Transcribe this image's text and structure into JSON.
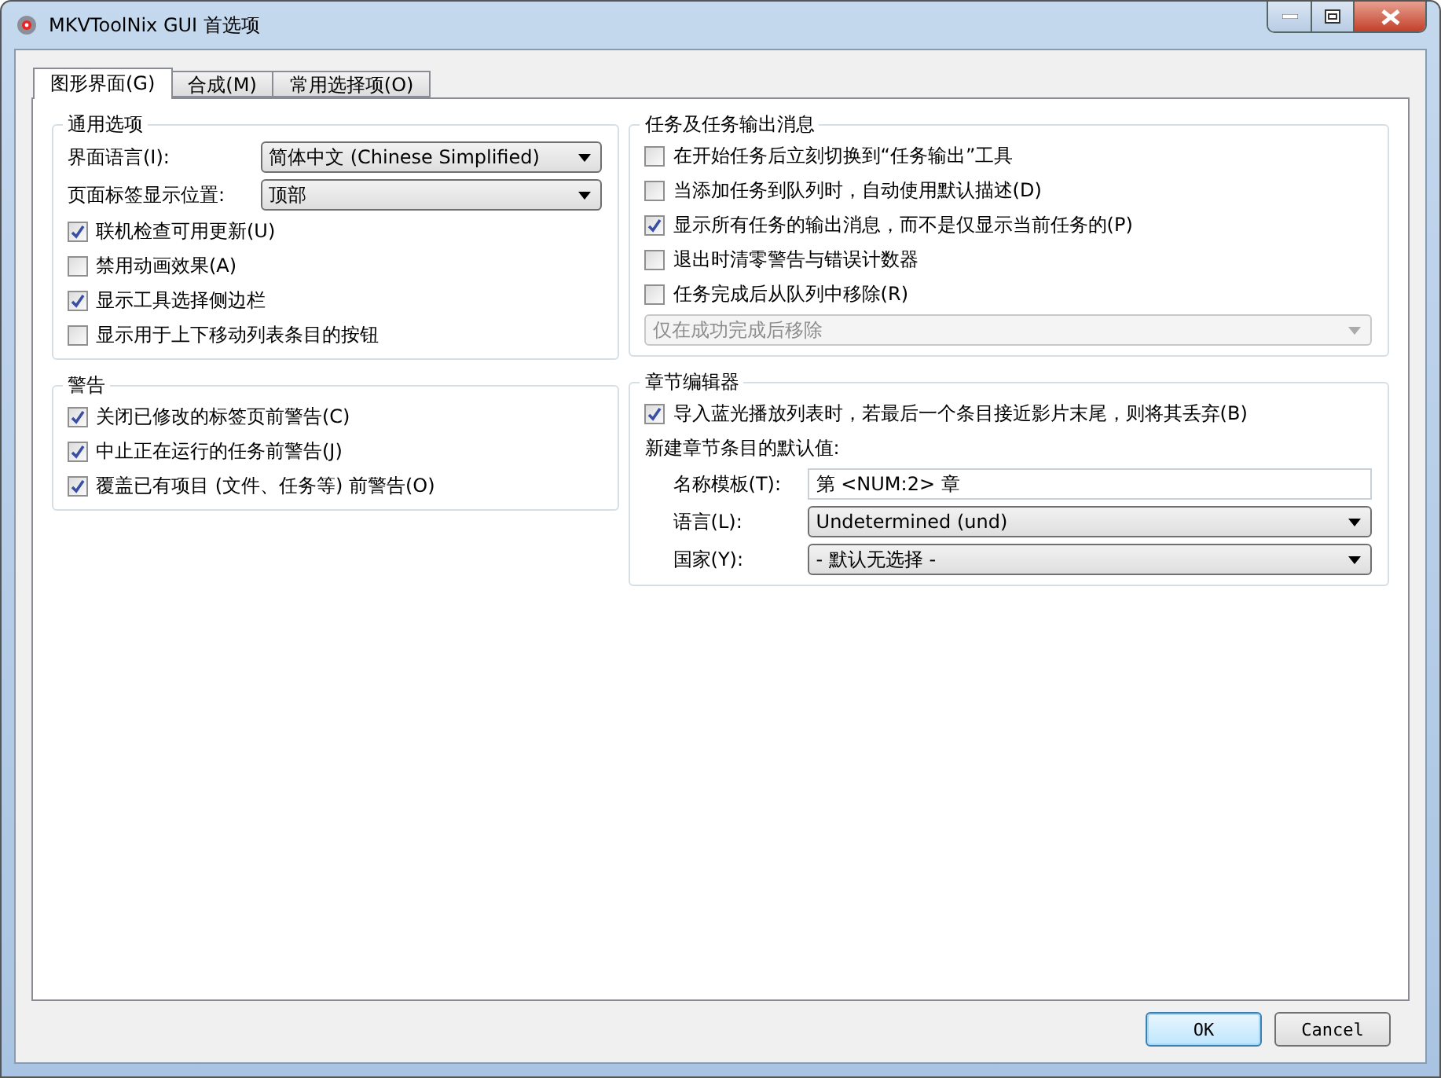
{
  "window": {
    "title": "MKVToolNix GUI 首选项"
  },
  "tabs": [
    {
      "label": "图形界面(G)",
      "selected": true
    },
    {
      "label": "合成(M)",
      "selected": false
    },
    {
      "label": "常用选择项(O)",
      "selected": false
    }
  ],
  "left": [
    {
      "title": "通用选项",
      "fields": [
        {
          "kind": "select",
          "label": "界面语言(I):",
          "value": "简体中文 (Chinese Simplified)",
          "disabled": false
        },
        {
          "kind": "select",
          "label": "页面标签显示位置:",
          "value": "顶部",
          "disabled": false
        }
      ],
      "options": [
        {
          "label": "联机检查可用更新(U)",
          "checked": true
        },
        {
          "label": "禁用动画效果(A)",
          "checked": false
        },
        {
          "label": "显示工具选择侧边栏",
          "checked": true
        },
        {
          "label": "显示用于上下移动列表条目的按钮",
          "checked": false
        }
      ]
    },
    {
      "title": "警告",
      "options": [
        {
          "label": "关闭已修改的标签页前警告(C)",
          "checked": true
        },
        {
          "label": "中止正在运行的任务前警告(J)",
          "checked": true
        },
        {
          "label": "覆盖已有项目 (文件、任务等) 前警告(O)",
          "checked": true
        }
      ]
    }
  ],
  "right": [
    {
      "title": "任务及任务输出消息",
      "options": [
        {
          "label": "在开始任务后立刻切换到“任务输出”工具",
          "checked": false
        },
        {
          "label": "当添加任务到队列时，自动使用默认描述(D)",
          "checked": false
        },
        {
          "label": "显示所有任务的输出消息，而不是仅显示当前任务的(P)",
          "checked": true
        },
        {
          "label": "退出时清零警告与错误计数器",
          "checked": false
        },
        {
          "label": "任务完成后从队列中移除(R)",
          "checked": false
        }
      ],
      "after": [
        {
          "kind": "select",
          "value": "仅在成功完成后移除",
          "disabled": true
        }
      ]
    },
    {
      "title": "章节编辑器",
      "options": [
        {
          "label": "导入蓝光播放列表时，若最后一个条目接近影片末尾，则将其丢弃(B)",
          "checked": true
        }
      ],
      "note": "新建章节条目的默认值:",
      "after": [
        {
          "kind": "text",
          "label": "名称模板(T):",
          "value": "第 <NUM:2> 章"
        },
        {
          "kind": "select",
          "label": "语言(L):",
          "value": "Undetermined (und)",
          "disabled": false
        },
        {
          "kind": "select",
          "label": "国家(Y):",
          "value": "- 默认无选择 -",
          "disabled": false
        }
      ]
    }
  ],
  "buttons": [
    {
      "label": "OK",
      "default": true
    },
    {
      "label": "Cancel",
      "default": false
    }
  ]
}
